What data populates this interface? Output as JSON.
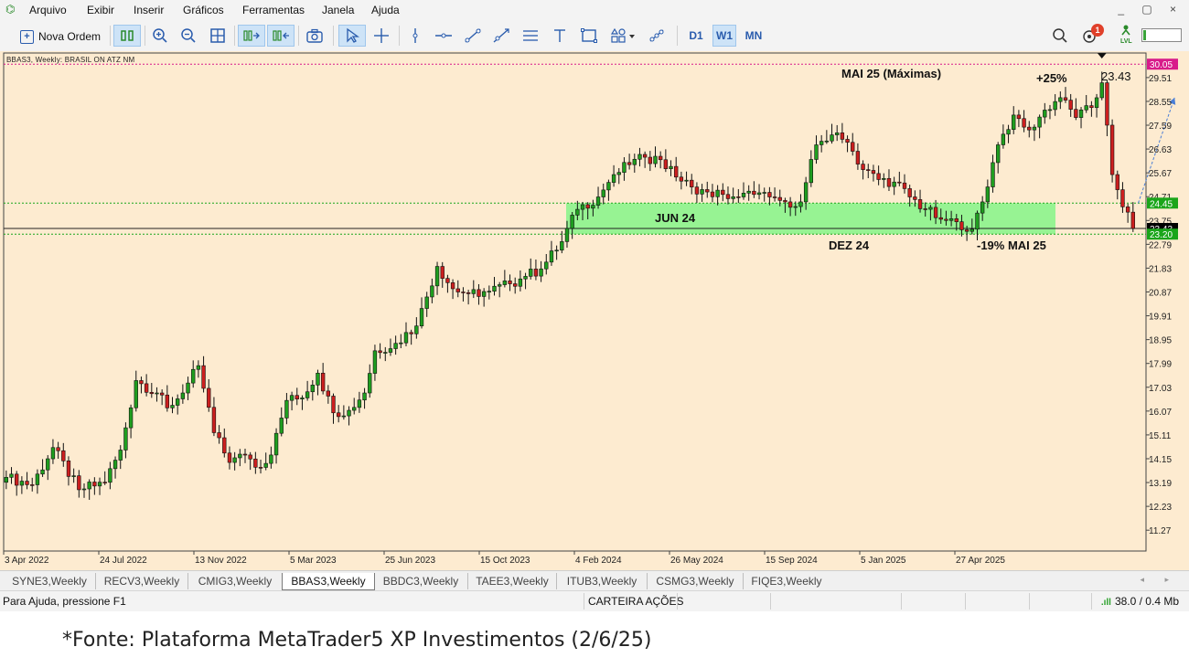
{
  "menu": {
    "items": [
      "Arquivo",
      "Exibir",
      "Inserir",
      "Gráficos",
      "Ferramentas",
      "Janela",
      "Ajuda"
    ],
    "window_controls": "_ ▢ ×"
  },
  "toolbar": {
    "new_order_label": "Nova Ordem",
    "timeframes": [
      "D1",
      "W1",
      "MN"
    ],
    "selected_timeframe": "W1",
    "notification_count": "1",
    "lvl_label": "LVL"
  },
  "chart": {
    "symbol_label": "BBAS3, Weekly: BRASIL  ON  ATZ NM",
    "annotations": {
      "max_label": "MAI 25 (Máximas)",
      "plus_label": "+25%",
      "target_value": "23.43",
      "zone_label": "JUN 24",
      "dez_label": "DEZ 24",
      "minus_label": "-19% MAI 25"
    },
    "price_tags": {
      "top": "30.05",
      "zone_top": "24.45",
      "current": "23.43",
      "zone_bottom": "23.20"
    },
    "colors": {
      "background": "#fdebd0",
      "bull": "#1f9e1f",
      "bear": "#cc1f1f",
      "zone": "#8cf48c",
      "tag_magenta": "#d81b8a",
      "tag_green": "#1aa51a",
      "tag_black": "#000000"
    }
  },
  "chart_data": {
    "type": "candlestick",
    "timeframe": "Weekly",
    "y_ticks": [
      30.05,
      29.51,
      28.55,
      27.59,
      26.63,
      25.67,
      24.71,
      23.75,
      22.79,
      21.83,
      20.87,
      19.91,
      18.95,
      17.99,
      17.03,
      16.07,
      15.11,
      14.15,
      13.19,
      12.23,
      11.27
    ],
    "ylim": [
      10.43,
      30.5
    ],
    "x_labels": [
      "3 Apr 2022",
      "24 Jul 2022",
      "13 Nov 2022",
      "5 Mar 2023",
      "25 Jun 2023",
      "15 Oct 2023",
      "4 Feb 2024",
      "26 May 2024",
      "15 Sep 2024",
      "5 Jan 2025",
      "27 Apr 2025"
    ],
    "zone": {
      "high": 24.45,
      "low": 23.2,
      "from": "JUN 24"
    },
    "horizontal_lines": [
      30.05,
      24.45,
      23.43,
      23.2
    ],
    "anchors": [
      [
        0,
        13.4
      ],
      [
        5,
        13.1
      ],
      [
        9,
        14.6
      ],
      [
        14,
        12.9
      ],
      [
        19,
        13.2
      ],
      [
        22,
        14.5
      ],
      [
        25,
        17.3
      ],
      [
        29,
        16.8
      ],
      [
        31,
        16.2
      ],
      [
        34,
        16.8
      ],
      [
        37,
        17.9
      ],
      [
        40,
        15.2
      ],
      [
        43,
        14.0
      ],
      [
        46,
        14.3
      ],
      [
        49,
        13.8
      ],
      [
        51,
        14.3
      ],
      [
        54,
        16.5
      ],
      [
        57,
        16.6
      ],
      [
        60,
        17.6
      ],
      [
        63,
        16.0
      ],
      [
        66,
        16.1
      ],
      [
        69,
        16.8
      ],
      [
        71,
        18.5
      ],
      [
        75,
        18.8
      ],
      [
        79,
        19.5
      ],
      [
        83,
        21.9
      ],
      [
        86,
        21.0
      ],
      [
        89,
        20.8
      ],
      [
        93,
        20.9
      ],
      [
        97,
        21.2
      ],
      [
        100,
        21.5
      ],
      [
        103,
        21.8
      ],
      [
        107,
        22.9
      ],
      [
        110,
        24.2
      ],
      [
        114,
        24.7
      ],
      [
        117,
        25.6
      ],
      [
        120,
        26.0
      ],
      [
        123,
        26.3
      ],
      [
        126,
        26.2
      ],
      [
        129,
        25.5
      ],
      [
        132,
        25.1
      ],
      [
        135,
        24.9
      ],
      [
        138,
        24.8
      ],
      [
        141,
        24.7
      ],
      [
        144,
        24.8
      ],
      [
        147,
        24.7
      ],
      [
        150,
        24.5
      ],
      [
        153,
        24.5
      ],
      [
        156,
        26.8
      ],
      [
        159,
        27.2
      ],
      [
        162,
        26.9
      ],
      [
        165,
        25.8
      ],
      [
        168,
        25.4
      ],
      [
        171,
        25.3
      ],
      [
        174,
        24.7
      ],
      [
        177,
        24.2
      ],
      [
        180,
        23.8
      ],
      [
        183,
        23.7
      ],
      [
        186,
        23.4
      ],
      [
        188,
        24.5
      ],
      [
        191,
        26.8
      ],
      [
        194,
        28.0
      ],
      [
        197,
        27.4
      ],
      [
        200,
        28.2
      ],
      [
        203,
        28.7
      ],
      [
        206,
        27.9
      ],
      [
        209,
        28.3
      ],
      [
        211,
        29.3
      ],
      [
        213,
        25.6
      ],
      [
        215,
        24.3
      ],
      [
        217,
        23.43
      ]
    ],
    "prediction_arrow": {
      "from_x": 218,
      "from_y": 24.45,
      "to_x": 225,
      "to_y": 28.7
    }
  },
  "tabs": {
    "items": [
      "SYNE3,Weekly",
      "RECV3,Weekly",
      "CMIG3,Weekly",
      "BBAS3,Weekly",
      "BBDC3,Weekly",
      "TAEE3,Weekly",
      "ITUB3,Weekly",
      "CSMG3,Weekly",
      "FIQE3,Weekly"
    ],
    "active": "BBAS3,Weekly",
    "scroll_arrows": "◂ ▸"
  },
  "status": {
    "help_text": "Para Ajuda, pressione F1",
    "portfolio": "CARTEIRA AÇÕES",
    "network": "38.0 / 0.4 Mb",
    "signal_icon": "signal-bars-icon"
  },
  "caption": "*Fonte: Plataforma MetaTrader5 XP Investimentos (2/6/25)"
}
